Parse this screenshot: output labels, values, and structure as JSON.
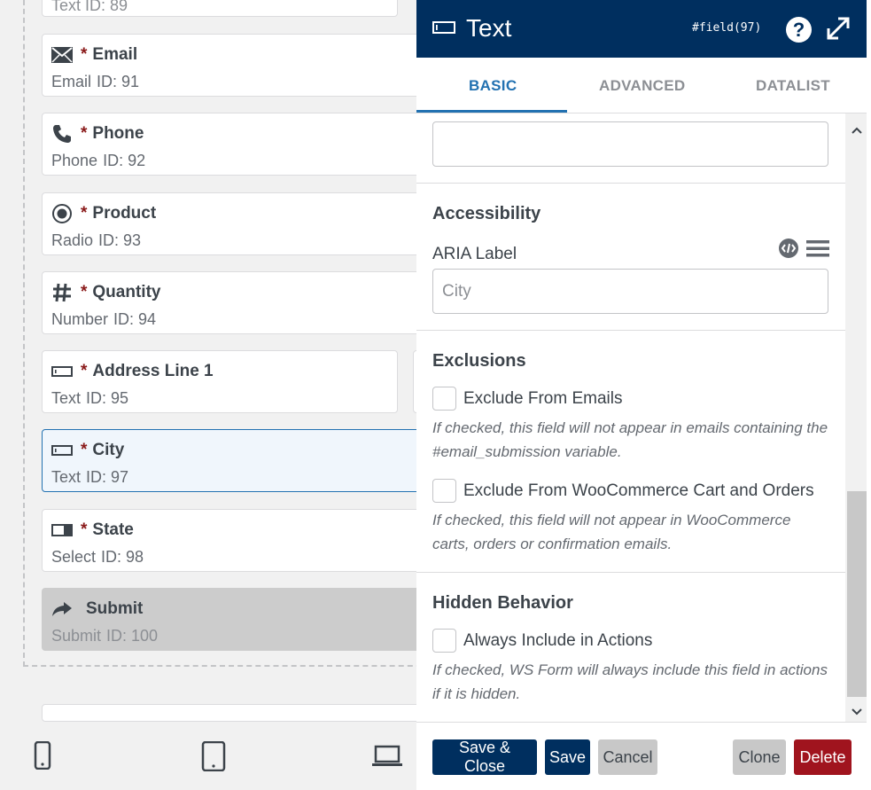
{
  "canvas": {
    "partial_top_label": "Text  ID: 89",
    "fields": [
      {
        "icon": "envelope-icon",
        "required": "*",
        "label": "Email",
        "type": "Email",
        "id": "ID: 91"
      },
      {
        "icon": "phone-icon",
        "required": "*",
        "label": "Phone",
        "type": "Phone",
        "id": "ID: 92"
      },
      {
        "icon": "radio-icon",
        "required": "*",
        "label": "Product",
        "type": "Radio",
        "id": "ID: 93"
      },
      {
        "icon": "hash-icon",
        "required": "*",
        "label": "Quantity",
        "type": "Number",
        "id": "ID: 94"
      },
      {
        "icon": "text-field-icon",
        "required": "*",
        "label": "Address Line 1",
        "type": "Text",
        "id": "ID: 95"
      },
      {
        "icon": "text-field-icon",
        "required": "*",
        "label": "City",
        "type": "Text",
        "id": "ID: 97"
      },
      {
        "icon": "select-icon",
        "required": "*",
        "label": "State",
        "type": "Select",
        "id": "ID: 98"
      },
      {
        "icon": "share-arrow-icon",
        "required": "",
        "label": "Submit",
        "type": "Submit",
        "id": "ID: 100"
      }
    ],
    "devices": [
      "mobile-icon",
      "tablet-icon",
      "laptop-icon"
    ]
  },
  "panel": {
    "title": "Text",
    "field_ref": "#field(97)",
    "help_glyph": "?",
    "tabs": [
      "BASIC",
      "ADVANCED",
      "DATALIST"
    ],
    "active_tab": "BASIC",
    "accessibility": {
      "title": "Accessibility",
      "aria_label": "ARIA Label",
      "aria_placeholder": "City"
    },
    "exclusions": {
      "title": "Exclusions",
      "exclude_emails": "Exclude From Emails",
      "exclude_emails_help": "If checked, this field will not appear in emails containing the #email_submission variable.",
      "exclude_woo": "Exclude From WooCommerce Cart and Orders",
      "exclude_woo_help": "If checked, this field will not appear in WooCommerce carts, orders or confirmation emails."
    },
    "hidden_behavior": {
      "title": "Hidden Behavior",
      "always_include": "Always Include in Actions",
      "always_include_help": "If checked, WS Form will always include this field in actions if it is hidden."
    },
    "footer": {
      "save_close": "Save & Close",
      "save": "Save",
      "cancel": "Cancel",
      "clone": "Clone",
      "delete": "Delete"
    },
    "colors": {
      "header": "#002f5f",
      "accent": "#2271b1",
      "delete": "#a0141e",
      "required": "#8a1a1a"
    }
  }
}
